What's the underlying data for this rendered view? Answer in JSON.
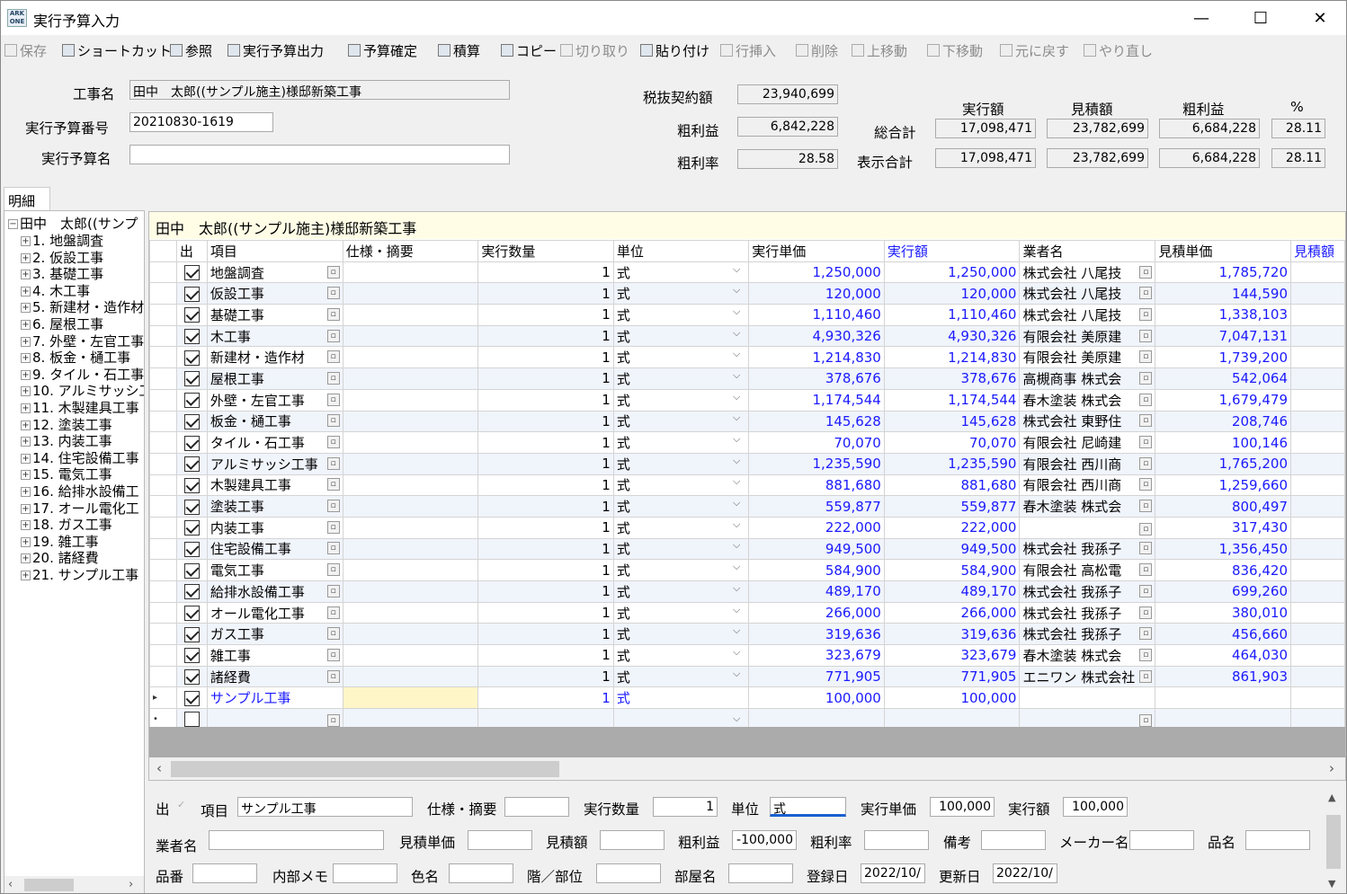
{
  "window": {
    "title": "実行予算入力",
    "app_icon_text": "ARK ONE",
    "minimize": "—",
    "maximize": "☐",
    "close": "✕"
  },
  "toolbar": [
    {
      "label": "保存",
      "icon": "save-icon",
      "enabled": false
    },
    {
      "label": "ショートカット",
      "icon": "shortcut-icon",
      "enabled": true
    },
    {
      "label": "参照",
      "icon": "reference-icon",
      "enabled": true
    },
    {
      "label": "実行予算出力",
      "icon": "print-icon",
      "enabled": true
    },
    {
      "label": "予算確定",
      "icon": "lock-icon",
      "enabled": true
    },
    {
      "label": "積算",
      "icon": "calc-grid-icon",
      "enabled": true
    },
    {
      "label": "コピー",
      "icon": "copy-icon",
      "enabled": true
    },
    {
      "label": "切り取り",
      "icon": "cut-icon",
      "enabled": false
    },
    {
      "label": "貼り付け",
      "icon": "paste-icon",
      "enabled": true
    },
    {
      "label": "行挿入",
      "icon": "insert-row-icon",
      "enabled": false
    },
    {
      "label": "削除",
      "icon": "delete-icon",
      "enabled": false
    },
    {
      "label": "上移動",
      "icon": "move-up-icon",
      "enabled": false
    },
    {
      "label": "下移動",
      "icon": "move-down-icon",
      "enabled": false
    },
    {
      "label": "元に戻す",
      "icon": "undo-icon",
      "enabled": false
    },
    {
      "label": "やり直し",
      "icon": "redo-icon",
      "enabled": false
    }
  ],
  "header": {
    "project_name_label": "工事名",
    "project_name": "田中　太郎((サンプル施主)様邸新築工事",
    "budget_no_label": "実行予算番号",
    "budget_no": "20210830-1619",
    "budget_name_label": "実行予算名",
    "budget_name": "",
    "contract_label": "税抜契約額",
    "contract_value": "23,940,699",
    "gross_label": "粗利益",
    "gross_value": "6,842,228",
    "gross_rate_label": "粗利率",
    "gross_rate_value": "28.58"
  },
  "summary": {
    "col_headers": [
      "実行額",
      "見積額",
      "粗利益",
      "%"
    ],
    "total_label": "総合計",
    "total": [
      "17,098,471",
      "23,782,699",
      "6,684,228",
      "28.11"
    ],
    "display_label": "表示合計",
    "display": [
      "17,098,471",
      "23,782,699",
      "6,684,228",
      "28.11"
    ]
  },
  "tab_label": "明細",
  "tree": {
    "root": "田中　太郎((サンプ",
    "items": [
      "1. 地盤調査",
      "2. 仮設工事",
      "3. 基礎工事",
      "4. 木工事",
      "5. 新建材・造作材",
      "6. 屋根工事",
      "7. 外壁・左官工事",
      "8. 板金・樋工事",
      "9. タイル・石工事",
      "10. アルミサッシ工",
      "11. 木製建具工事",
      "12. 塗装工事",
      "13. 内装工事",
      "14. 住宅設備工事",
      "15. 電気工事",
      "16. 給排水設備工",
      "17. オール電化工",
      "18. ガス工事",
      "19. 雑工事",
      "20. 諸経費",
      "21. サンプル工事"
    ]
  },
  "grid": {
    "title": "田中　太郎((サンプル施主)様邸新築工事",
    "headers": [
      "出",
      "項目",
      "仕様・摘要",
      "実行数量",
      "単位",
      "実行単価",
      "実行額",
      "業者名",
      "見積単価",
      "見積額"
    ],
    "rows": [
      {
        "item": "地盤調査",
        "qty": "1",
        "unit": "式",
        "unit_price": "1,250,000",
        "amount": "1,250,000",
        "vendor": "株式会社 八尾技",
        "est_price": "1,785,720"
      },
      {
        "item": "仮設工事",
        "qty": "1",
        "unit": "式",
        "unit_price": "120,000",
        "amount": "120,000",
        "vendor": "株式会社 八尾技",
        "est_price": "144,590"
      },
      {
        "item": "基礎工事",
        "qty": "1",
        "unit": "式",
        "unit_price": "1,110,460",
        "amount": "1,110,460",
        "vendor": "株式会社 八尾技",
        "est_price": "1,338,103"
      },
      {
        "item": "木工事",
        "qty": "1",
        "unit": "式",
        "unit_price": "4,930,326",
        "amount": "4,930,326",
        "vendor": "有限会社 美原建",
        "est_price": "7,047,131"
      },
      {
        "item": "新建材・造作材",
        "qty": "1",
        "unit": "式",
        "unit_price": "1,214,830",
        "amount": "1,214,830",
        "vendor": "有限会社 美原建",
        "est_price": "1,739,200"
      },
      {
        "item": "屋根工事",
        "qty": "1",
        "unit": "式",
        "unit_price": "378,676",
        "amount": "378,676",
        "vendor": "高槻商事 株式会",
        "est_price": "542,064"
      },
      {
        "item": "外壁・左官工事",
        "qty": "1",
        "unit": "式",
        "unit_price": "1,174,544",
        "amount": "1,174,544",
        "vendor": "春木塗装 株式会",
        "est_price": "1,679,479"
      },
      {
        "item": "板金・樋工事",
        "qty": "1",
        "unit": "式",
        "unit_price": "145,628",
        "amount": "145,628",
        "vendor": "株式会社 東野住",
        "est_price": "208,746"
      },
      {
        "item": "タイル・石工事",
        "qty": "1",
        "unit": "式",
        "unit_price": "70,070",
        "amount": "70,070",
        "vendor": "有限会社 尼崎建",
        "est_price": "100,146"
      },
      {
        "item": "アルミサッシ工事",
        "qty": "1",
        "unit": "式",
        "unit_price": "1,235,590",
        "amount": "1,235,590",
        "vendor": "有限会社 西川商",
        "est_price": "1,765,200"
      },
      {
        "item": "木製建具工事",
        "qty": "1",
        "unit": "式",
        "unit_price": "881,680",
        "amount": "881,680",
        "vendor": "有限会社 西川商",
        "est_price": "1,259,660"
      },
      {
        "item": "塗装工事",
        "qty": "1",
        "unit": "式",
        "unit_price": "559,877",
        "amount": "559,877",
        "vendor": "春木塗装 株式会",
        "est_price": "800,497"
      },
      {
        "item": "内装工事",
        "qty": "1",
        "unit": "式",
        "unit_price": "222,000",
        "amount": "222,000",
        "vendor": "",
        "est_price": "317,430"
      },
      {
        "item": "住宅設備工事",
        "qty": "1",
        "unit": "式",
        "unit_price": "949,500",
        "amount": "949,500",
        "vendor": "株式会社 我孫子",
        "est_price": "1,356,450"
      },
      {
        "item": "電気工事",
        "qty": "1",
        "unit": "式",
        "unit_price": "584,900",
        "amount": "584,900",
        "vendor": "有限会社 高松電",
        "est_price": "836,420"
      },
      {
        "item": "給排水設備工事",
        "qty": "1",
        "unit": "式",
        "unit_price": "489,170",
        "amount": "489,170",
        "vendor": "株式会社 我孫子",
        "est_price": "699,260"
      },
      {
        "item": "オール電化工事",
        "qty": "1",
        "unit": "式",
        "unit_price": "266,000",
        "amount": "266,000",
        "vendor": "株式会社 我孫子",
        "est_price": "380,010"
      },
      {
        "item": "ガス工事",
        "qty": "1",
        "unit": "式",
        "unit_price": "319,636",
        "amount": "319,636",
        "vendor": "株式会社 我孫子",
        "est_price": "456,660"
      },
      {
        "item": "雑工事",
        "qty": "1",
        "unit": "式",
        "unit_price": "323,679",
        "amount": "323,679",
        "vendor": "春木塗装 株式会",
        "est_price": "464,030"
      },
      {
        "item": "諸経費",
        "qty": "1",
        "unit": "式",
        "unit_price": "771,905",
        "amount": "771,905",
        "vendor": "エニワン 株式会社",
        "est_price": "861,903"
      }
    ],
    "current_row": {
      "item": "サンプル工事",
      "qty": "1",
      "unit": "式",
      "unit_price": "100,000",
      "amount": "100,000"
    }
  },
  "detail": {
    "out_label": "出",
    "item_label": "項目",
    "item_value": "サンプル工事",
    "spec_label": "仕様・摘要",
    "spec_value": "",
    "qty_label": "実行数量",
    "qty_value": "1",
    "unit_label": "単位",
    "unit_value": "式",
    "unit_price_label": "実行単価",
    "unit_price_value": "100,000",
    "amount_label": "実行額",
    "amount_value": "100,000",
    "vendor_label": "業者名",
    "vendor_value": "",
    "est_price_label": "見積単価",
    "est_price_value": "",
    "est_amount_label": "見積額",
    "est_amount_value": "",
    "gross_label": "粗利益",
    "gross_value": "-100,000",
    "gross_rate_label": "粗利率",
    "gross_rate_value": "",
    "note_label": "備考",
    "note_value": "",
    "maker_label": "メーカー名",
    "maker_value": "",
    "product_label": "品名",
    "product_value": "",
    "product_no_label": "品番",
    "product_no_value": "",
    "memo_label": "内部メモ",
    "memo_value": "",
    "color_label": "色名",
    "color_value": "",
    "floor_label": "階／部位",
    "floor_value": "",
    "room_label": "部屋名",
    "room_value": "",
    "created_label": "登録日",
    "created_value": "2022/10/",
    "updated_label": "更新日",
    "updated_value": "2022/10/"
  }
}
